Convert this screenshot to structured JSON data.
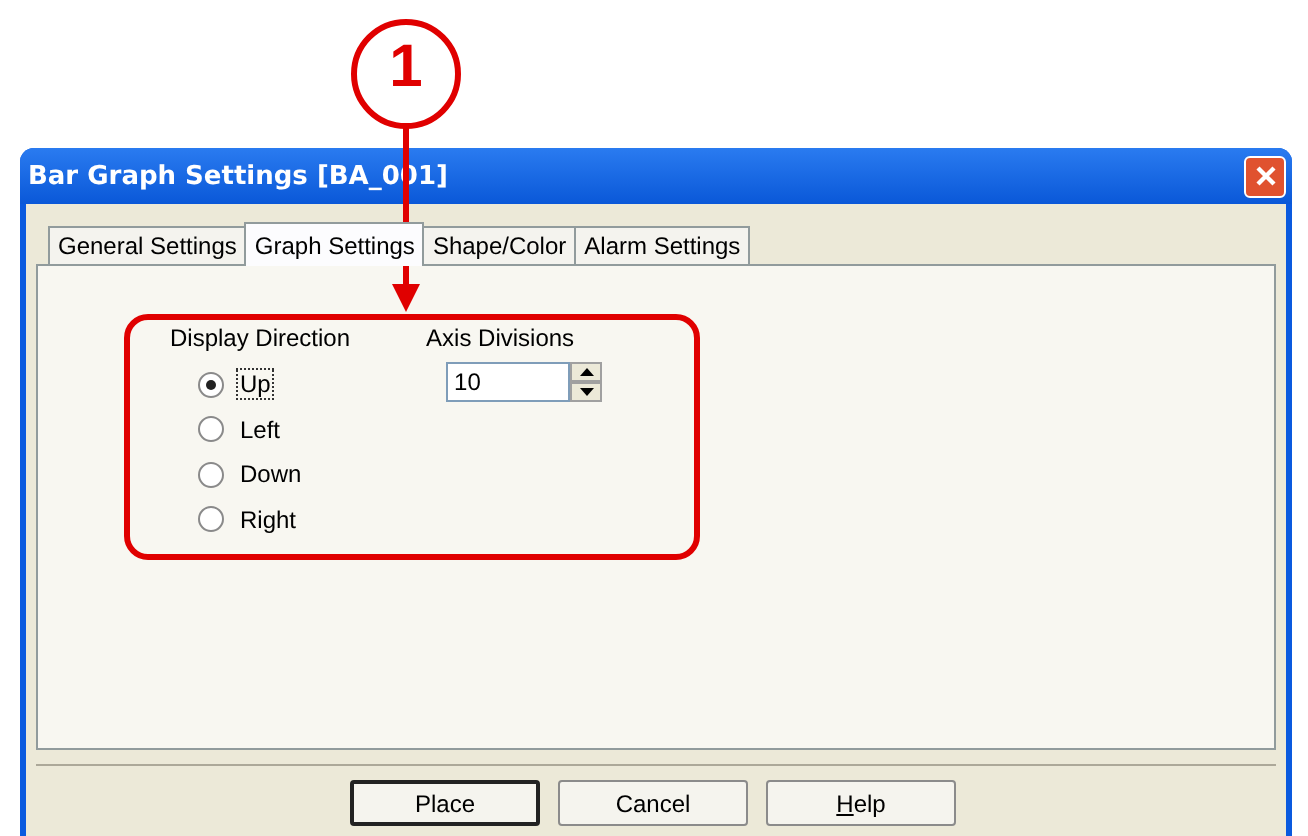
{
  "callout": {
    "label": "1"
  },
  "window": {
    "title": "Bar Graph Settings [BA_001]"
  },
  "tabs": [
    {
      "label": "General Settings",
      "selected": false
    },
    {
      "label": "Graph Settings",
      "selected": true
    },
    {
      "label": "Shape/Color",
      "selected": false
    },
    {
      "label": "Alarm Settings",
      "selected": false
    }
  ],
  "display_direction": {
    "label": "Display Direction",
    "options": [
      {
        "label": "Up",
        "selected": true,
        "focused": true
      },
      {
        "label": "Left",
        "selected": false,
        "focused": false
      },
      {
        "label": "Down",
        "selected": false,
        "focused": false
      },
      {
        "label": "Right",
        "selected": false,
        "focused": false
      }
    ]
  },
  "axis_divisions": {
    "label": "Axis Divisions",
    "value": "10"
  },
  "buttons": [
    {
      "label": "Place",
      "default": true,
      "mnemonic": false
    },
    {
      "label": "Cancel",
      "default": false,
      "mnemonic": false
    },
    {
      "label": "Help",
      "default": false,
      "mnemonic": true
    }
  ]
}
